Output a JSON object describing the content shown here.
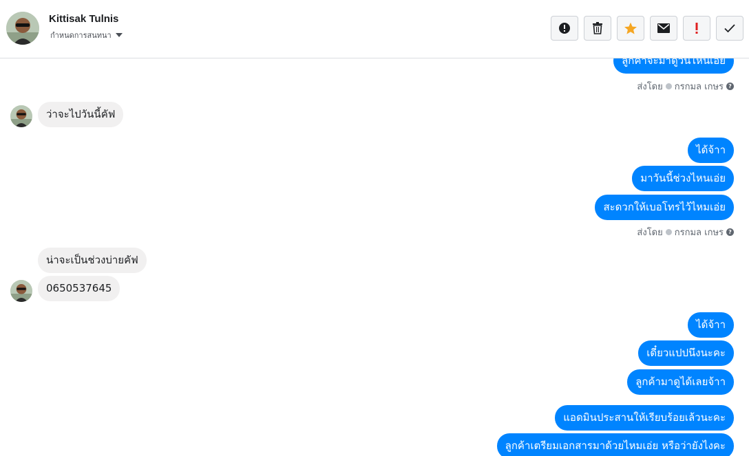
{
  "header": {
    "contact_name": "Kittisak Tulnis",
    "assign_label": "กำหนดการสนทนา"
  },
  "toolbar": {
    "buttons": [
      {
        "icon": "alert-circle-icon",
        "color": "#1c1e21"
      },
      {
        "icon": "trash-icon",
        "color": "#1c1e21"
      },
      {
        "icon": "star-icon",
        "color": "#f5a623"
      },
      {
        "icon": "envelope-icon",
        "color": "#1c1e21"
      },
      {
        "icon": "exclamation-icon",
        "color": "#e02020"
      },
      {
        "icon": "checkmark-icon",
        "color": "#1c1e21"
      }
    ]
  },
  "colors": {
    "outgoing_bubble": "#0084ff",
    "incoming_bubble": "#f1f0f0"
  },
  "messages": {
    "m0": "ลูกค้าจะมาดูวันไหนเอ่ย",
    "sent0_prefix": "ส่งโดย",
    "sent0_name": "กรกมล เกษร",
    "m1": "ว่าจะไปวันนี้คัฟ",
    "m2": "ได้จ้าา",
    "m3": "มาวันนี้ช่วงไหนเอ่ย",
    "m4": "สะดวกให้เบอโทรไว้ไหมเอ่ย",
    "sent1_prefix": "ส่งโดย",
    "sent1_name": "กรกมล เกษร",
    "m5": "น่าจะเป็นช่วงบ่ายคัฟ",
    "m6": "0650537645",
    "m7": "ได้จ้าา",
    "m8": "เดี๋ยวแปปนึงนะคะ",
    "m9": "ลูกค้ามาดูได้เลยจ้าา",
    "m10": "แอดมินประสานให้เรียบร้อยเล้วนะคะ",
    "m11": "ลูกค้าเตรียมเอกสารมาด้วยไหมเอ่ย หรือว่ายังไงคะ"
  }
}
